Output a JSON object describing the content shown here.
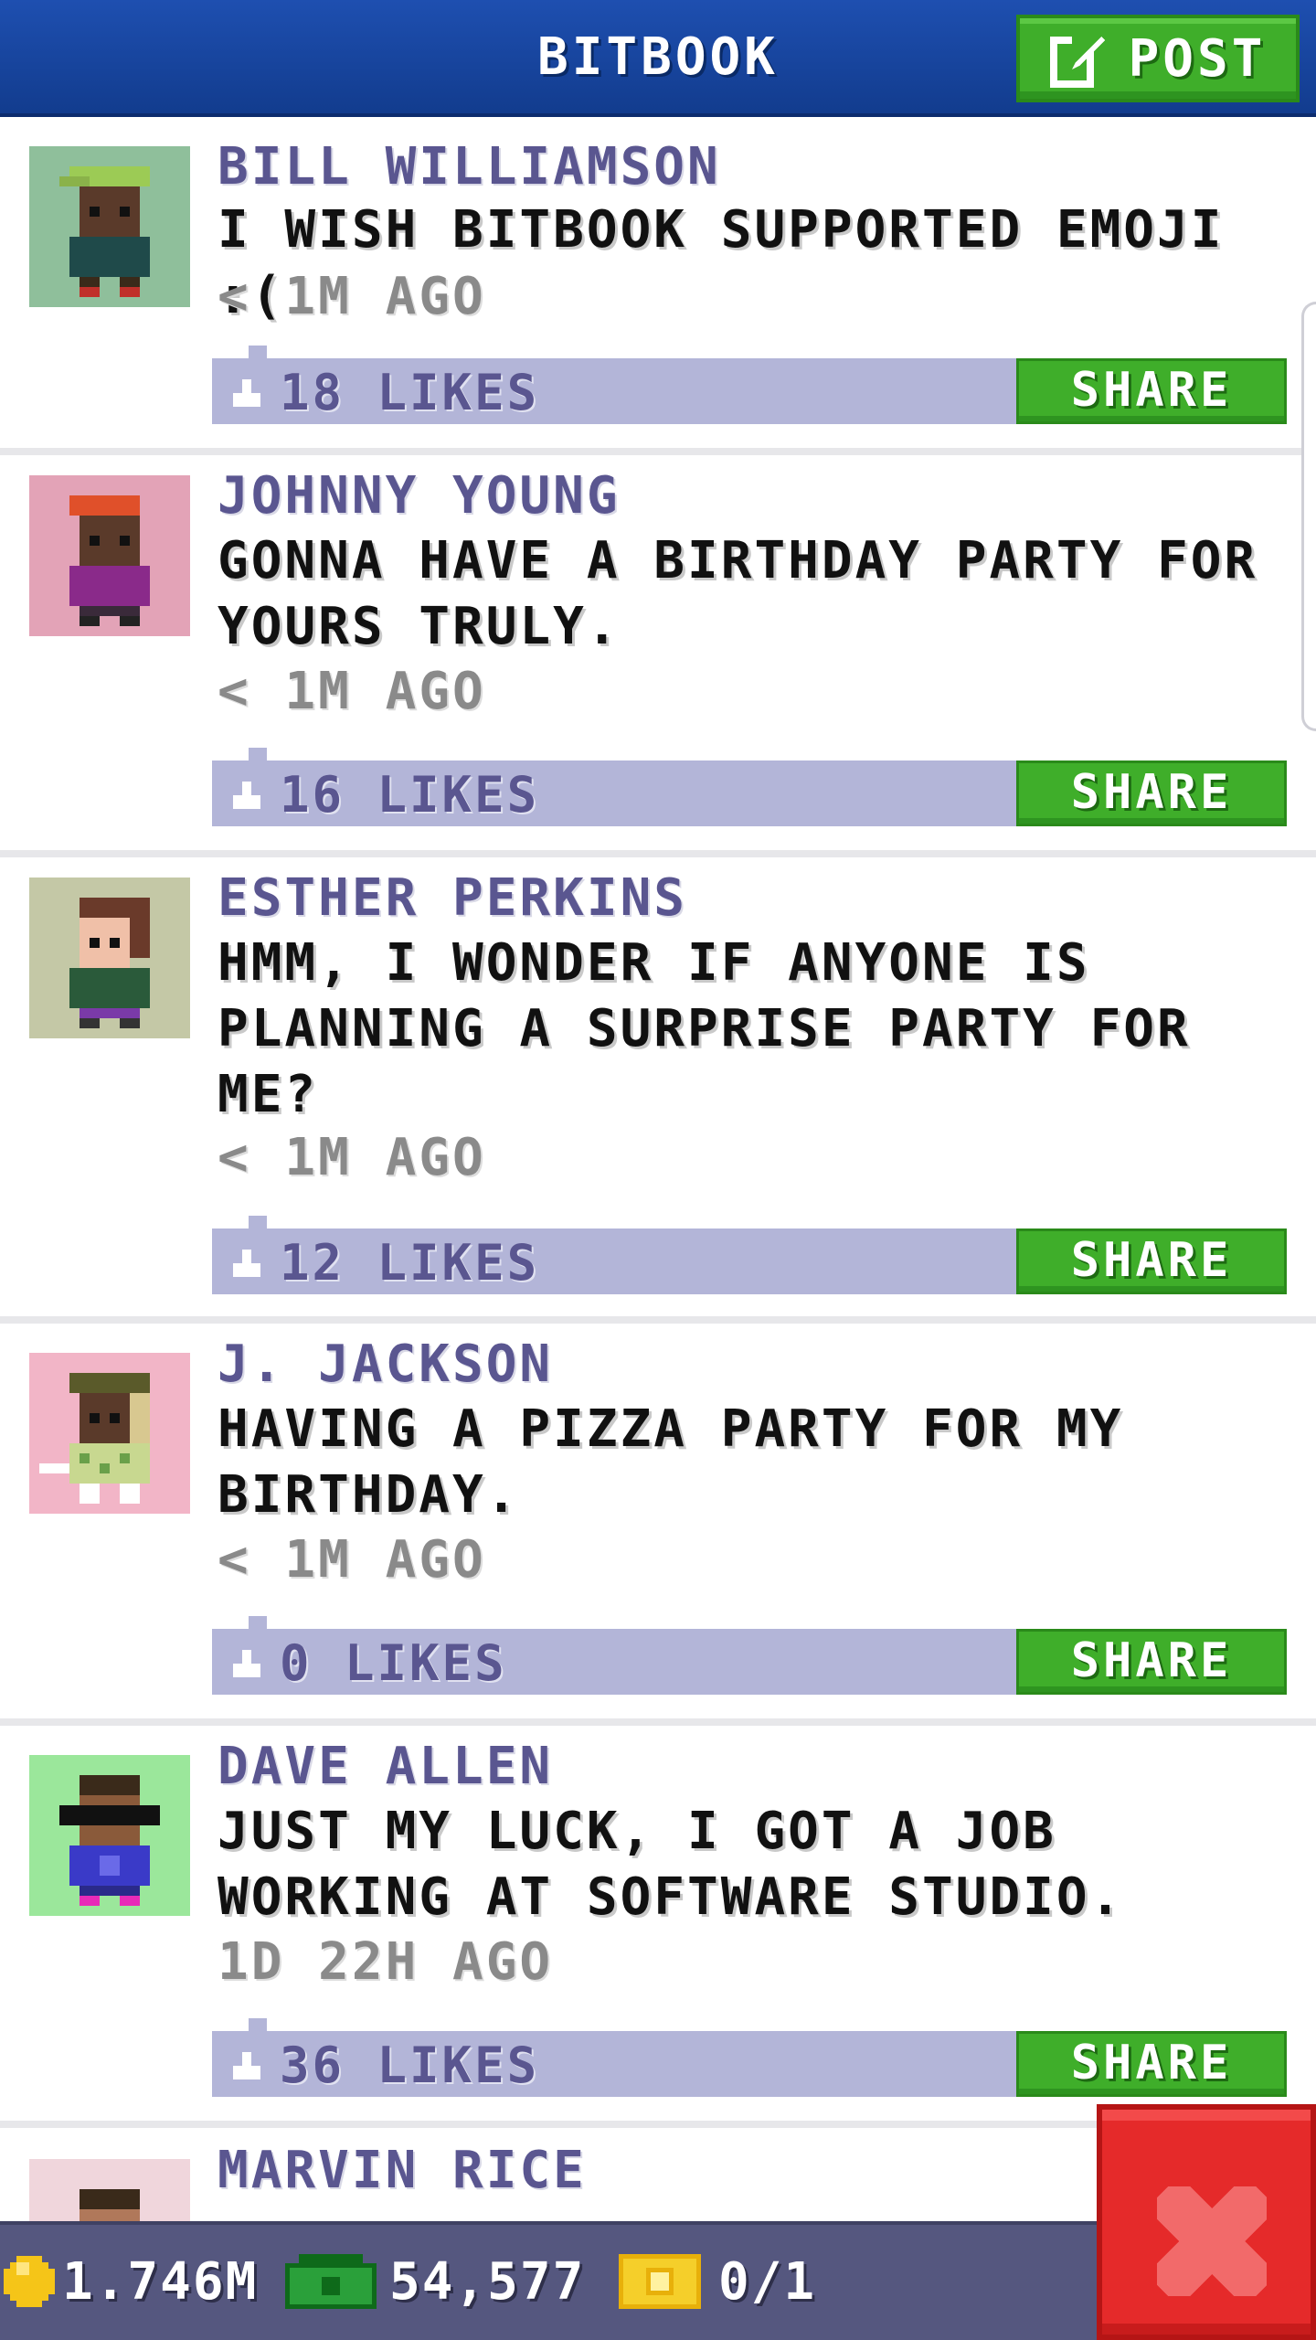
{
  "header": {
    "title": "BITBOOK",
    "post_label": "POST",
    "post_icon": "edit-icon",
    "color": "#1a4aa8"
  },
  "feed": {
    "share_label": "SHARE",
    "posts": [
      {
        "name": "BILL WILLIAMSON",
        "text": "I WISH BITBOOK SUPPORTED EMOJI :(",
        "time": "< 1M AGO",
        "likes": "18 LIKES",
        "avatar_bg": "#8fbf9b"
      },
      {
        "name": "JOHNNY YOUNG",
        "text": "GONNA HAVE A BIRTHDAY PARTY FOR YOURS TRULY.",
        "time": "< 1M AGO",
        "likes": "16 LIKES",
        "avatar_bg": "#e3a3b7"
      },
      {
        "name": "ESTHER PERKINS",
        "text": "HMM, I WONDER IF ANYONE IS PLANNING A SURPRISE PARTY FOR ME?",
        "time": "< 1M AGO",
        "likes": "12 LIKES",
        "avatar_bg": "#c4c8a6"
      },
      {
        "name": "J. JACKSON",
        "text": "HAVING A PIZZA PARTY FOR MY BIRTHDAY.",
        "time": "< 1M AGO",
        "likes": "0 LIKES",
        "avatar_bg": "#f2b5c7"
      },
      {
        "name": "DAVE ALLEN",
        "text": "JUST MY LUCK, I GOT A JOB WORKING AT SOFTWARE STUDIO.",
        "time": "1D 22H AGO",
        "likes": "36 LIKES",
        "avatar_bg": "#9be79b"
      },
      {
        "name": "MARVIN RICE",
        "avatar_bg": "#f0d6dc"
      }
    ]
  },
  "bottom_bar": {
    "coins": "1.746M",
    "cash": "54,577",
    "tickets": "0/1"
  },
  "close_icon": "close-icon"
}
